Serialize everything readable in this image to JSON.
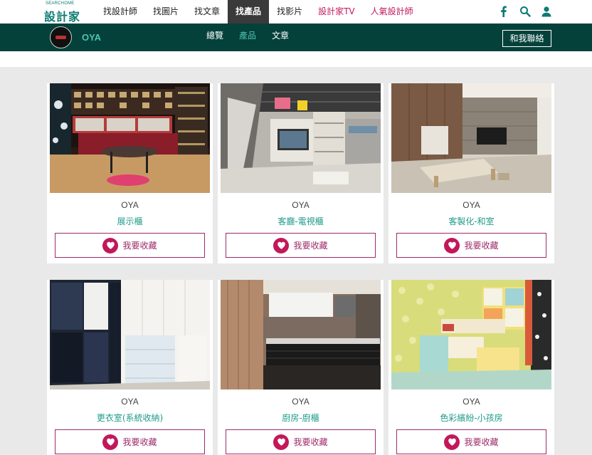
{
  "header": {
    "logo_en": "SEARCHOME",
    "logo_zh": "設計家",
    "menu": [
      {
        "label": "找設計師"
      },
      {
        "label": "找圖片"
      },
      {
        "label": "找文章"
      },
      {
        "label": "找產品",
        "active": true
      },
      {
        "label": "找影片"
      },
      {
        "label": "設計家TV"
      },
      {
        "label": "人氣設計師",
        "hot": true
      }
    ],
    "icons": [
      "facebook-icon",
      "search-icon",
      "user-icon"
    ]
  },
  "subnav": {
    "brand": "OYA",
    "tabs": [
      {
        "label": "總覽"
      },
      {
        "label": "產品",
        "active": true
      },
      {
        "label": "文章"
      }
    ],
    "contact_label": "和我聯絡"
  },
  "cards": [
    {
      "maker": "OYA",
      "category": "展示櫃",
      "fav_label": "我要收藏"
    },
    {
      "maker": "OYA",
      "category": "客廳-電視櫃",
      "fav_label": "我要收藏"
    },
    {
      "maker": "OYA",
      "category": "客製化-和室",
      "fav_label": "我要收藏"
    },
    {
      "maker": "OYA",
      "category": "更衣室(系統收納)",
      "fav_label": "我要收藏"
    },
    {
      "maker": "OYA",
      "category": "廚房-廚櫃",
      "fav_label": "我要收藏"
    },
    {
      "maker": "OYA",
      "category": "色彩繽紛-小孩房",
      "fav_label": "我要收藏"
    }
  ],
  "colors": {
    "brand_teal": "#04413b",
    "accent_teal": "#1f9b8a",
    "favorite_magenta": "#c2185b"
  }
}
